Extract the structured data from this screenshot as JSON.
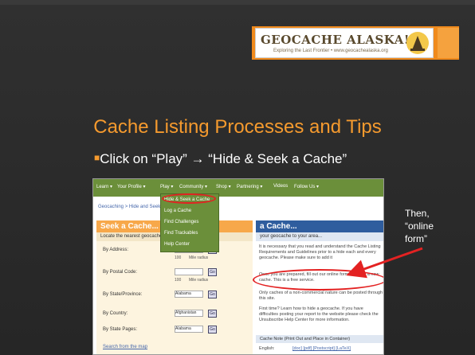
{
  "logo": {
    "title": "GEOCACHE ALASKA!",
    "subtitle": "Exploring the Last Frontier • www.geocachealaska.org"
  },
  "slide_title": "Cache Listing Processes and Tips",
  "bullet": "Click on “Play” → “Hide & Seek a Cache”",
  "annotation": "Then, “online form”",
  "screenshot": {
    "nav": [
      "Learn ▾",
      "Your Profile ▾",
      "Play ▾",
      "Community ▾",
      "Shop ▾",
      "Partnering ▾",
      "Videos",
      "Follow Us ▾"
    ],
    "breadcrumb": "Geocaching > Hide and Seek A Cache",
    "dropdown": [
      "Hide & Seek a Cache",
      "Log a Cache",
      "Find Challenges",
      "Find Trackables",
      "Help Center"
    ],
    "left_title": "Seek a Cache...",
    "left_subtitle": "Locate the nearest geocache",
    "fields": [
      {
        "label": "By Address:",
        "value": "",
        "hint": "100",
        "unit": "Mile radius"
      },
      {
        "label": "By Postal Code:",
        "value": "",
        "hint": "100",
        "unit": "Mile radius"
      },
      {
        "label": "By State/Province:",
        "value": "Alabama",
        "hint": "",
        "unit": ""
      },
      {
        "label": "By Country:",
        "value": "Afghanistan",
        "hint": "",
        "unit": ""
      },
      {
        "label": "By State Pages:",
        "value": "Alabama",
        "hint": "",
        "unit": ""
      }
    ],
    "go": "Go",
    "left_link": "Search from the map",
    "right_title": "a Cache...",
    "right_subtitle": "your geocache to your area...",
    "right_p1": "It is necessary that you read and understand the Cache Listing Requirements and Guidelines prior to a hide each and every geocache. Please make sure to add it",
    "right_p2": "Once you are prepared, fill out our online form to report a new cache. This is a free service.",
    "right_p3": "Only caches of a non-commercial nature can be posted through this site.",
    "right_p4": "First time? Learn how to hide a geocache. If you have difficulties posting your report to the website please check the Unsubscribe Help Center for more information.",
    "right_bar": "Cache Note (Print Out and Place in Container)",
    "right_lang": "English:",
    "right_lang_files": "[doc] [pdf] [Postscript] [LaTeX]"
  },
  "colors": {
    "accent": "#f59a2e",
    "background": "#2b2b2b",
    "annotation_red": "#e32222"
  }
}
